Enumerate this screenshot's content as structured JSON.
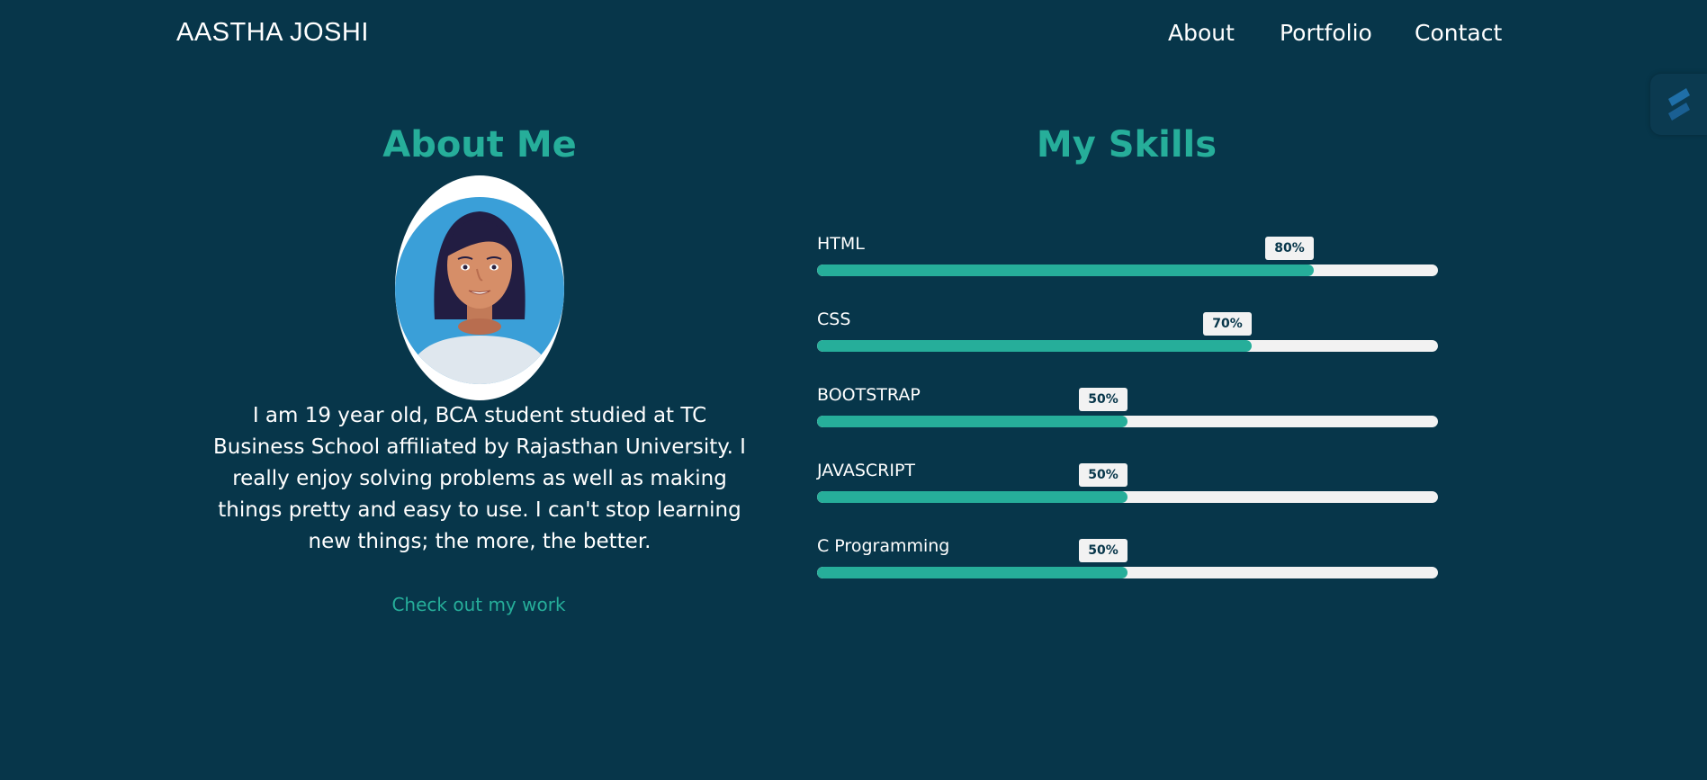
{
  "header": {
    "brand": "AASTHA JOSHI",
    "nav": {
      "about": "About",
      "portfolio": "Portfolio",
      "contact": "Contact"
    }
  },
  "about": {
    "title": "About Me",
    "bio": "I am 19 year old, BCA student studied at TC Business School affiliated by Rajasthan University. I really enjoy solving problems as well as making things pretty and easy to use. I can't stop learning new things; the more, the better.",
    "cta": "Check out my work"
  },
  "skills": {
    "title": "My Skills",
    "items": [
      {
        "name": "HTML",
        "percent_label": "80%",
        "level": 0.8
      },
      {
        "name": "CSS",
        "percent_label": "70%",
        "level": 0.7
      },
      {
        "name": "BOOTSTRAP",
        "percent_label": "50%",
        "level": 0.5
      },
      {
        "name": "JAVASCRIPT",
        "percent_label": "50%",
        "level": 0.5
      },
      {
        "name": "C Programming",
        "percent_label": "50%",
        "level": 0.5
      }
    ]
  },
  "colors": {
    "background": "#07364a",
    "accent": "#26ae9a",
    "track": "#f2f2f2",
    "avatar_bg": "#3a9fd8"
  },
  "icons": {
    "side_widget": "floating-tool-icon",
    "avatar": "avatar-illustration"
  }
}
